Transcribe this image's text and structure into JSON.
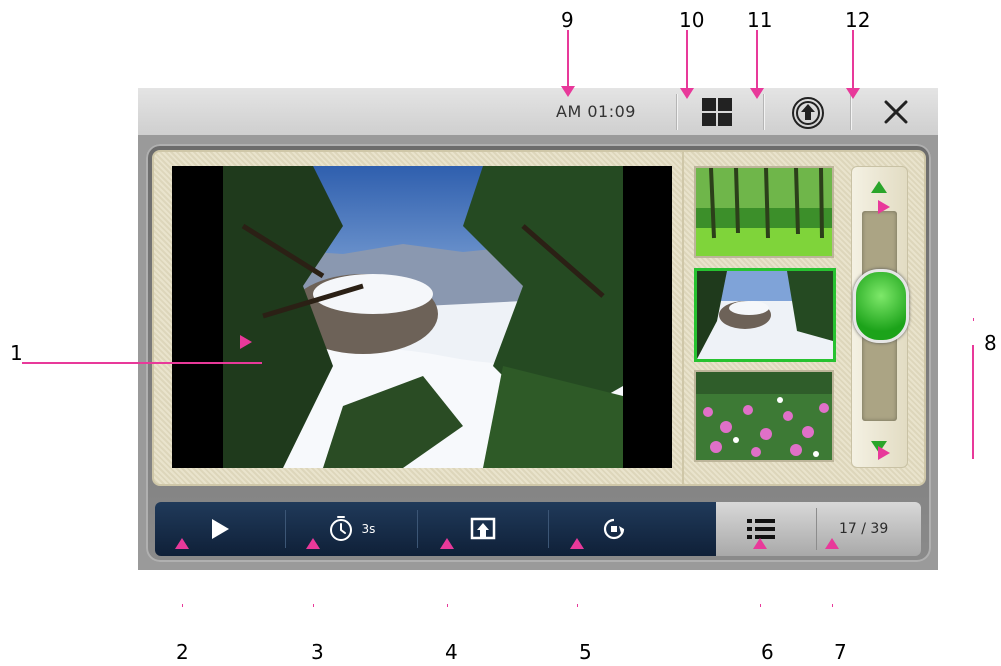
{
  "status_bar": {
    "clock": "AM 01:09"
  },
  "toolbar": {
    "timer_label": "3s"
  },
  "counter": "17 / 39",
  "annotations": [
    "1",
    "2",
    "3",
    "4",
    "5",
    "6",
    "7",
    "8",
    "9",
    "10",
    "11",
    "12"
  ],
  "colors": {
    "toolbar": "#132a46",
    "accent_green": "#27c230",
    "annotation_pink": "#e8399a",
    "stage": "#e6e0c8"
  },
  "icons": {
    "multi_view": "grid-icon",
    "upload": "upload-circle-icon",
    "close": "close-icon",
    "play": "play-icon",
    "timer": "stopwatch-icon",
    "export": "export-screen-icon",
    "rotate": "rotate-icon",
    "list": "list-icon"
  }
}
